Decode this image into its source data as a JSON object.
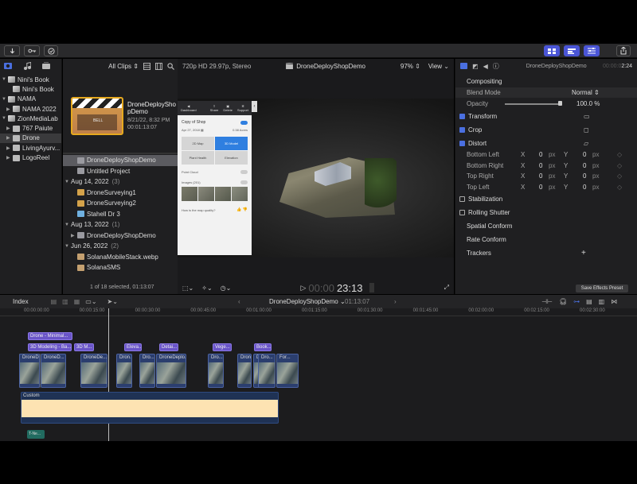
{
  "toolbar": {
    "colors": {
      "accent": "#4a55d6"
    }
  },
  "library": {
    "items": [
      {
        "label": "Nini's Book",
        "indent": 0,
        "tri": "▼",
        "icon": "star",
        "selected": false
      },
      {
        "label": "Nini's Book",
        "indent": 1,
        "tri": "",
        "icon": "star",
        "selected": false
      },
      {
        "label": "NAMA",
        "indent": 0,
        "tri": "▼",
        "icon": "star",
        "selected": false
      },
      {
        "label": "NAMA 2022",
        "indent": 1,
        "tri": "▶",
        "icon": "star",
        "selected": false
      },
      {
        "label": "ZionMediaLab",
        "indent": 0,
        "tri": "▼",
        "icon": "star",
        "selected": false
      },
      {
        "label": "767 Paiute",
        "indent": 1,
        "tri": "▶",
        "icon": "event",
        "selected": false
      },
      {
        "label": "Drone",
        "indent": 1,
        "tri": "▶",
        "icon": "event",
        "selected": true
      },
      {
        "label": "LivingAyurv...",
        "indent": 1,
        "tri": "▶",
        "icon": "event",
        "selected": false
      },
      {
        "label": "LogoReel",
        "indent": 1,
        "tri": "▶",
        "icon": "event",
        "selected": false
      }
    ]
  },
  "browser": {
    "filter_label": "All Clips",
    "format_label": "720p HD 29.97p, Stereo",
    "clip": {
      "title": "DroneDeployShopDemo",
      "date": "8/21/22, 8:32 PM",
      "duration": "00:01:13:07",
      "thumb_text": "BELL"
    },
    "list": [
      {
        "type": "item",
        "label": "DroneDeployShopDemo",
        "selected": true,
        "tri": "",
        "icon": "project"
      },
      {
        "type": "item",
        "label": "Untitled Project",
        "selected": false,
        "tri": "",
        "icon": "project"
      },
      {
        "type": "group",
        "label": "Aug 14, 2022",
        "count": "(3)"
      },
      {
        "type": "item",
        "label": "DroneSurveying1",
        "selected": false,
        "tri": "",
        "icon": "clip"
      },
      {
        "type": "item",
        "label": "DroneSurveying2",
        "selected": false,
        "tri": "",
        "icon": "clip"
      },
      {
        "type": "item",
        "label": "Stahell Dr 3",
        "selected": false,
        "tri": "",
        "icon": "audio"
      },
      {
        "type": "group",
        "label": "Aug 13, 2022",
        "count": "(1)"
      },
      {
        "type": "item",
        "label": "DroneDeployShopDemo",
        "selected": false,
        "tri": "▶",
        "icon": "project"
      },
      {
        "type": "group",
        "label": "Jun 26, 2022",
        "count": "(2)"
      },
      {
        "type": "item",
        "label": "SolanaMobileStack.webp",
        "selected": false,
        "tri": "",
        "icon": "image"
      },
      {
        "type": "item",
        "label": "SolanaSMS",
        "selected": false,
        "tri": "",
        "icon": "image"
      }
    ],
    "status": "1 of 18 selected, 01:13:07"
  },
  "viewer": {
    "title": "DroneDeployShopDemo",
    "zoom": "97%",
    "view_label": "View",
    "timecode": "23:13",
    "timecode_dim": "00:00",
    "phone": {
      "dashboard": "Dashboard",
      "share": "Share",
      "delete": "Delete",
      "support": "Support",
      "project": "Copy of Shop",
      "date": "Apr 27, 2018",
      "acres": "0.38 Acres",
      "map2d": "2D Map",
      "model3d": "3D Model",
      "plant": "Plant Health",
      "elev": "Elevation",
      "pointcloud": "Point Cloud",
      "images": "Images (201)",
      "question": "How is the map quality?"
    }
  },
  "inspector": {
    "title": "DroneDeployShopDemo",
    "time": "2:24",
    "time_dim": "00:00:0",
    "sections": {
      "compositing": "Compositing",
      "blend_label": "Blend Mode",
      "blend_value": "Normal",
      "opacity_label": "Opacity",
      "opacity_value": "100.0",
      "opacity_unit": "%",
      "opacity_level": 1.0,
      "transform": "Transform",
      "crop": "Crop",
      "distort": "Distort",
      "bl": "Bottom Left",
      "br": "Bottom Right",
      "tr": "Top Right",
      "tl": "Top Left",
      "x": "X",
      "y": "Y",
      "zero": "0",
      "px": "px",
      "stabilization": "Stabilization",
      "rolling": "Rolling Shutter",
      "spatial": "Spatial Conform",
      "rate": "Rate Conform",
      "trackers": "Trackers",
      "save_preset": "Save Effects Preset"
    }
  },
  "timeline": {
    "index_label": "Index",
    "project": "DroneDeployShopDemo",
    "duration": "01:13:07",
    "ruler": [
      "00:00:00:00",
      "00:00:15:00",
      "00:00:30:00",
      "00:00:45:00",
      "00:01:00:00",
      "00:01:15:00",
      "00:01:30:00",
      "00:01:45:00",
      "00:02:00:00",
      "00:02:15:00",
      "00:02:30:00"
    ],
    "connected_top": {
      "label": "Drone - Minimal..."
    },
    "connected": [
      {
        "label": "3D Modeling - Ba..."
      },
      {
        "label": "3D M..."
      },
      {
        "label": "Eleva..."
      },
      {
        "label": "Detai..."
      },
      {
        "label": "Vege..."
      },
      {
        "label": "Book..."
      }
    ],
    "clips": [
      {
        "label": "DroneD..."
      },
      {
        "label": "DroneD..."
      },
      {
        "label": "DroneDe..."
      },
      {
        "label": "Dron..."
      },
      {
        "label": "Dro..."
      },
      {
        "label": "DroneDeplo..."
      },
      {
        "label": "Dro..."
      },
      {
        "label": "Dron..."
      },
      {
        "label": "Dro..."
      },
      {
        "label": "Dro..."
      },
      {
        "label": "For..."
      }
    ],
    "audio_label": "Custom",
    "title_clip": "T-Ne..."
  }
}
